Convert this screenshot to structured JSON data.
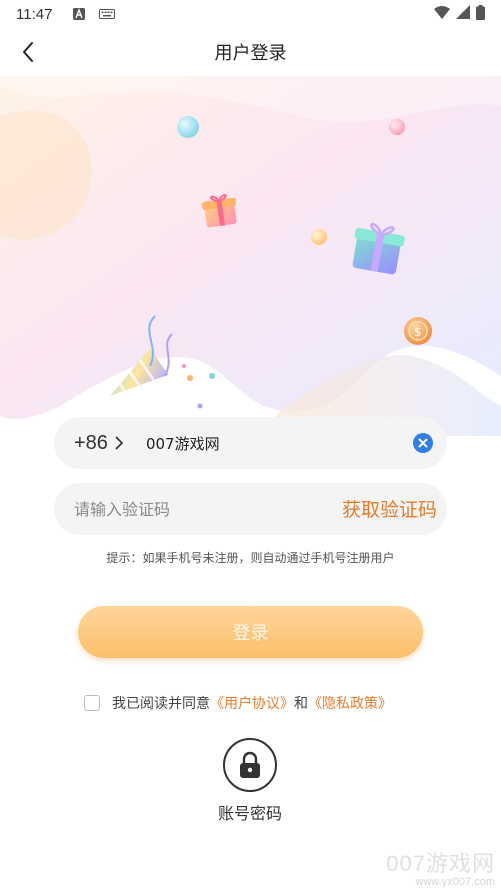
{
  "status_bar": {
    "time": "11:47",
    "icons": [
      "text-a-icon",
      "keyboard-icon",
      "wifi-icon",
      "signal-icon",
      "battery-icon"
    ]
  },
  "nav": {
    "title": "用户登录",
    "back_icon": "chevron-left-icon"
  },
  "phone": {
    "country_code": "+86",
    "value": "007游戏网",
    "clear_icon": "clear-circle-icon"
  },
  "code": {
    "placeholder": "请输入验证码",
    "get_code_label": "获取验证码"
  },
  "hint": "提示：如果手机号未注册，则自动通过手机号注册用户",
  "login_label": "登录",
  "agreement": {
    "prefix": "我已阅读并同意",
    "user_agreement": "《用户协议》",
    "and": "和",
    "privacy_policy": "《隐私政策》",
    "checked": false
  },
  "account_login": {
    "label": "账号密码",
    "icon": "lock-icon"
  },
  "watermark": {
    "main": "007游戏网",
    "url": "www.yx007.com"
  },
  "colors": {
    "accent": "#e87c2c",
    "login_button": "#fbc77a",
    "field_bg": "#f4f4f4",
    "clear_icon": "#2f7fe6"
  }
}
